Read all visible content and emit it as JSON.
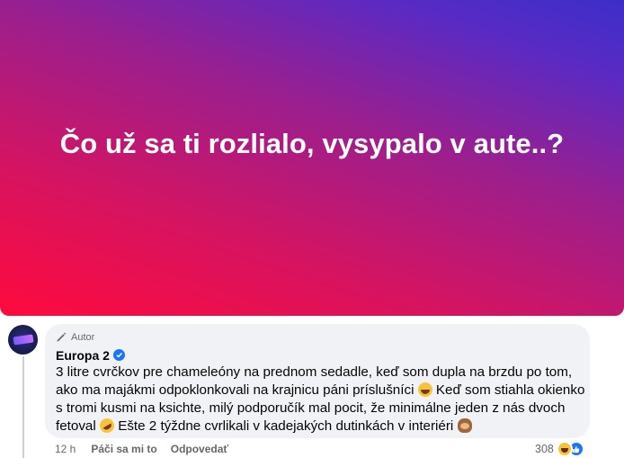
{
  "post": {
    "banner_text": "Čo už sa ti rozlialo, vysypalo v aute..?",
    "banner_colors": [
      "#ff0a3d",
      "#9a1f8f",
      "#3c2ec9"
    ]
  },
  "comment": {
    "badge_label": "Autor",
    "author_name": "Europa 2",
    "verified": true,
    "text_part1": "3 litre cvrčkov pre chameleóny na prednom sedadle, keď som dupla na brzdu po tom, ako ma majákmi odpoklonkovali na krajnicu páni príslušníci ",
    "text_part2": " Keď som stiahla okienko s tromi kusmi na ksichte, milý podporučík mal pocit, že minimálne jeden z nás dvoch fetoval ",
    "text_part3": " Ešte 2 týždne cvrlikali v kadejakých dutinkách v interiéri ",
    "emojis": [
      "grinning-sweat-emoji",
      "rofl-emoji",
      "see-no-evil-monkey-emoji"
    ],
    "time": "12 h",
    "like_label": "Páči sa mi to",
    "reply_label": "Odpovedať",
    "reaction_count": "308",
    "reaction_icons": [
      "haha-reaction-icon",
      "like-reaction-icon"
    ]
  },
  "colors": {
    "bubble_bg": "#f0f2f5",
    "meta_text": "#65676b",
    "verified_blue": "#1877f2"
  }
}
